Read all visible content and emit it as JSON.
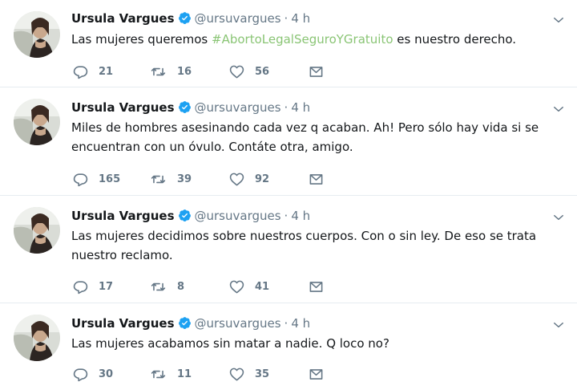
{
  "tweets": [
    {
      "name": "Ursula Vargues",
      "handle": "@ursuvargues",
      "time": "4 h",
      "text_before": "Las mujeres queremos ",
      "hashtag": "#AbortoLegalSeguroYGratuito",
      "text_after": " es nuestro derecho.",
      "replies": "21",
      "retweets": "16",
      "likes": "56"
    },
    {
      "name": "Ursula Vargues",
      "handle": "@ursuvargues",
      "time": "4 h",
      "text": "Miles de hombres asesinando cada vez q acaban. Ah! Pero sólo hay vida si se encuentran con un óvulo.  Contáte otra, amigo.",
      "replies": "165",
      "retweets": "39",
      "likes": "92"
    },
    {
      "name": "Ursula Vargues",
      "handle": "@ursuvargues",
      "time": "4 h",
      "text": "Las mujeres decidimos sobre nuestros cuerpos. Con o sin ley. De eso se trata nuestro reclamo.",
      "replies": "17",
      "retweets": "8",
      "likes": "41"
    },
    {
      "name": "Ursula Vargues",
      "handle": "@ursuvargues",
      "time": "4 h",
      "text": "Las mujeres acabamos sin matar a nadie. Q loco no?",
      "replies": "30",
      "retweets": "11",
      "likes": "35"
    }
  ],
  "separator": "·",
  "icons": {
    "verified": "verified-badge-icon",
    "caret": "chevron-down-icon",
    "reply": "reply-icon",
    "retweet": "retweet-icon",
    "like": "heart-icon",
    "dm": "envelope-icon"
  },
  "colors": {
    "hashtag": "#8ac575",
    "verified": "#1da1f2",
    "muted": "#657786",
    "text": "#14171a"
  }
}
